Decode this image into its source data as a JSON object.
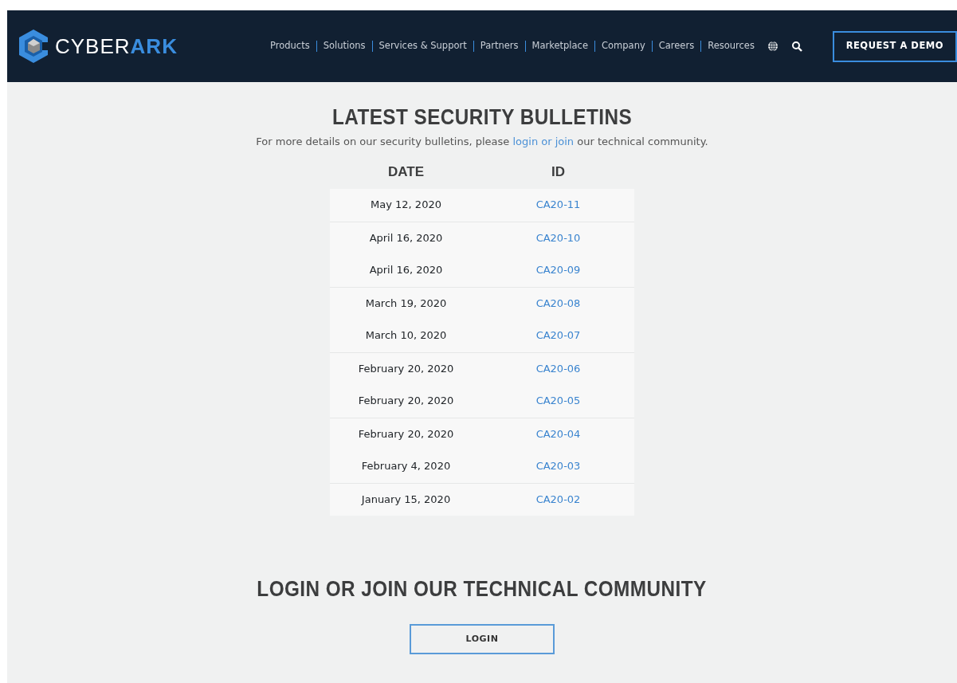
{
  "header": {
    "logo": "CYBER**ARK**",
    "nav": [
      "Products",
      "Solutions",
      "Services & Support",
      "Partners",
      "Marketplace",
      "Company",
      "Careers",
      "Resources"
    ],
    "cta": "REQUEST A DEMO"
  },
  "bulletins": {
    "title": "LATEST SECURITY BULLETINS",
    "intro_before": "For more details on our security bulletins, please",
    "intro_link": "login or join",
    "intro_after": "our technical community.",
    "columns": [
      "DATE",
      "ID"
    ],
    "rows": [
      {
        "date": "May 12, 2020",
        "id": "CA20-11",
        "group_start": false
      },
      {
        "date": "April 16, 2020",
        "id": "CA20-10",
        "group_start": true
      },
      {
        "date": "April 16, 2020",
        "id": "CA20-09",
        "group_start": false
      },
      {
        "date": "March 19, 2020",
        "id": "CA20-08",
        "group_start": true
      },
      {
        "date": "March 10, 2020",
        "id": "CA20-07",
        "group_start": false
      },
      {
        "date": "February 20, 2020",
        "id": "CA20-06",
        "group_start": true
      },
      {
        "date": "February 20, 2020",
        "id": "CA20-05",
        "group_start": false
      },
      {
        "date": "February 20, 2020",
        "id": "CA20-04",
        "group_start": true
      },
      {
        "date": "February 4, 2020",
        "id": "CA20-03",
        "group_start": false
      },
      {
        "date": "January 15, 2020",
        "id": "CA20-02",
        "group_start": true
      }
    ]
  },
  "community": {
    "title": "LOGIN OR JOIN OUR TECHNICAL COMMUNITY",
    "button": "LOGIN"
  }
}
